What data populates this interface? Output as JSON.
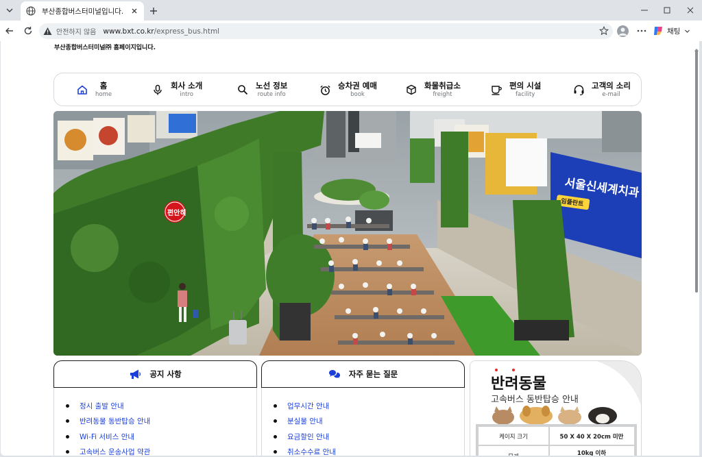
{
  "browser": {
    "tab_title": "부산종합버스터미널입니다.",
    "security_label": "안전하지 않음",
    "url_host": "www.bxt.co.kr",
    "url_path": "/express_bus.html",
    "chat_label": "채팅"
  },
  "page": {
    "heading": "부산종합버스터미널㈜ 홈페이지입니다."
  },
  "gnb": {
    "items": [
      {
        "ko": "홈",
        "en": "home",
        "icon": "home-icon"
      },
      {
        "ko": "회사 소개",
        "en": "intro",
        "icon": "microphone-icon"
      },
      {
        "ko": "노선 정보",
        "en": "route info",
        "icon": "search-icon"
      },
      {
        "ko": "승차권 예매",
        "en": "book",
        "icon": "alarm-clock-icon"
      },
      {
        "ko": "화물취급소",
        "en": "freight",
        "icon": "box-icon"
      },
      {
        "ko": "편의 시설",
        "en": "facility",
        "icon": "cup-icon"
      },
      {
        "ko": "고객의 소리",
        "en": "e-mail",
        "icon": "headset-icon"
      }
    ]
  },
  "hero": {
    "sign_text": "편안히",
    "banner_text": "서울신세계치과",
    "banner_badge": "임플란트",
    "accent_green": "#3f7a2a"
  },
  "notice": {
    "title": "공지 사항",
    "items": [
      "정시 출발 안내",
      "반려동물 동반탑승 안내",
      "Wi-Fi 서비스 안내",
      "고속버스 운송사업 약관"
    ]
  },
  "faq": {
    "title": "자주 묻는 질문",
    "items": [
      "업무시간 안내",
      "분실물 안내",
      "요금할인 안내",
      "취소수수료 안내"
    ]
  },
  "promo": {
    "title": "반려동물",
    "subtitle": "고속버스 동반탑승 안내",
    "rows": [
      {
        "label": "케이지 크기",
        "value": "50 X 40 X 20cm 미만"
      },
      {
        "label": "무게",
        "value": "10kg 이하"
      }
    ]
  },
  "colors": {
    "link_blue": "#1b3fd8",
    "icon_blue": "#1b3fd8",
    "chrome_bg": "#dfe3e8"
  }
}
